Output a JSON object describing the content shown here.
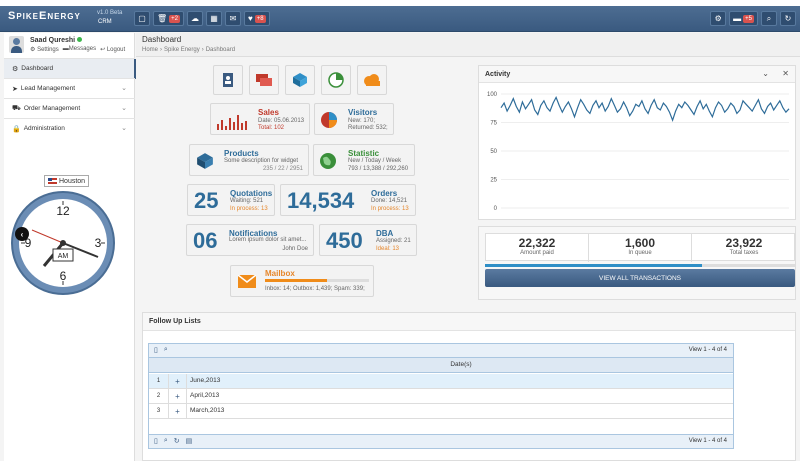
{
  "brand": {
    "name": "SpikeEnergy",
    "version": "v1.0 Beta",
    "sub": "CRM"
  },
  "navbar": {
    "left": [
      {
        "icon": "desktop-icon",
        "glyph": "▢",
        "badge": ""
      },
      {
        "icon": "trash-icon",
        "glyph": "🗑",
        "badge": "+2"
      },
      {
        "icon": "cloud-icon",
        "glyph": "☁",
        "badge": ""
      },
      {
        "icon": "calendar-icon",
        "glyph": "▦",
        "badge": ""
      },
      {
        "icon": "envelope-icon",
        "glyph": "✉",
        "badge": ""
      },
      {
        "icon": "heart-icon",
        "glyph": "♥",
        "badge": "+8"
      }
    ],
    "right": [
      {
        "icon": "gear-icon",
        "glyph": "⚙",
        "badge": ""
      },
      {
        "icon": "comment-icon",
        "glyph": "▬",
        "badge": "+5"
      },
      {
        "icon": "search-icon",
        "glyph": "⌕",
        "badge": ""
      },
      {
        "icon": "refresh-icon",
        "glyph": "↻",
        "badge": ""
      }
    ]
  },
  "user": {
    "name": "Saad Qureshi",
    "settings": "Settings",
    "messages": "Messages",
    "logout": "Logout"
  },
  "menu": [
    {
      "label": "Dashboard",
      "icon": "dashboard-icon",
      "glyph": "⚙",
      "active": true
    },
    {
      "label": "Lead Management",
      "icon": "paper-plane-icon",
      "glyph": "➤"
    },
    {
      "label": "Order Management",
      "icon": "cart-icon",
      "glyph": "⛟"
    },
    {
      "label": "Administration",
      "icon": "lock-icon",
      "glyph": "🔒"
    }
  ],
  "clock": {
    "city": "Houston",
    "ampm": "AM"
  },
  "header": {
    "title": "Dashboard",
    "crumbs": [
      "Home",
      "›",
      "Spike Energy",
      "›",
      "Dashboard"
    ]
  },
  "tiles": {
    "sales": {
      "title": "Sales",
      "date": "Date: 05.06.2013",
      "total": "Total: 102"
    },
    "visitors": {
      "title": "Visitors",
      "new": "New: 170;",
      "returned": "Returned: 532;"
    },
    "products": {
      "title": "Products",
      "desc": "Some description for widget",
      "nums": "235 / 22 / 2951"
    },
    "statistic": {
      "title": "Statistic",
      "sub": "New / Today / Week",
      "nums": "793 / 13,388 / 292,260"
    },
    "quotations": {
      "num": "25",
      "title": "Quotations",
      "waiting": "Waiting: 521",
      "process": "In process: 13"
    },
    "orders": {
      "num": "14,534",
      "title": "Orders",
      "done": "Done: 14,521",
      "process": "In process: 13"
    },
    "notifications": {
      "num": "06",
      "title": "Notifications",
      "desc": "Lorem ipsum dolor sit amet...",
      "author": "John Doe"
    },
    "dba": {
      "num": "450",
      "title": "DBA",
      "assigned": "Assigned: 21",
      "ideal": "Ideal: 13"
    },
    "mailbox": {
      "title": "Mailbox",
      "stats": "Inbox: 14; Outbox: 1,439; Spam: 339;",
      "progress": 0.6
    }
  },
  "activity": {
    "title": "Activity",
    "yticks": [
      "100",
      "75",
      "50",
      "25",
      "0"
    ]
  },
  "chart_data": {
    "type": "line",
    "title": "Activity",
    "ylim": [
      0,
      100
    ],
    "values": [
      88,
      92,
      85,
      90,
      96,
      89,
      84,
      93,
      87,
      91,
      95,
      86,
      82,
      90,
      94,
      88,
      85,
      92,
      97,
      90,
      84,
      89,
      93,
      87,
      80,
      88,
      95,
      91,
      86,
      83,
      90,
      94,
      88,
      92,
      85,
      89,
      96,
      90,
      84,
      87,
      93,
      88,
      81,
      85,
      91,
      89,
      94,
      87,
      83,
      90,
      95,
      88,
      86,
      92,
      89,
      84,
      77,
      85,
      91,
      88,
      93,
      90,
      86,
      82,
      89,
      94,
      87,
      91,
      85,
      80,
      88,
      93,
      90,
      84,
      87,
      92,
      89,
      83,
      86,
      94,
      91,
      88,
      85,
      90,
      95,
      87,
      83,
      89,
      92,
      86,
      90,
      94,
      88,
      84,
      87
    ]
  },
  "transactions": {
    "paid": {
      "value": "22,322",
      "label": "Amount paid"
    },
    "queue": {
      "value": "1,600",
      "label": "In queue"
    },
    "taxes": {
      "value": "23,922",
      "label": "Total taxes"
    },
    "progress": 0.7,
    "button": "VIEW ALL TRANSACTIONS"
  },
  "followup": {
    "title": "Follow Up Lists",
    "view": "View 1 - 4 of 4",
    "column": "Date(s)",
    "rows": [
      {
        "n": "1",
        "date": "June,2013"
      },
      {
        "n": "2",
        "date": "April,2013"
      },
      {
        "n": "3",
        "date": "March,2013"
      }
    ]
  }
}
